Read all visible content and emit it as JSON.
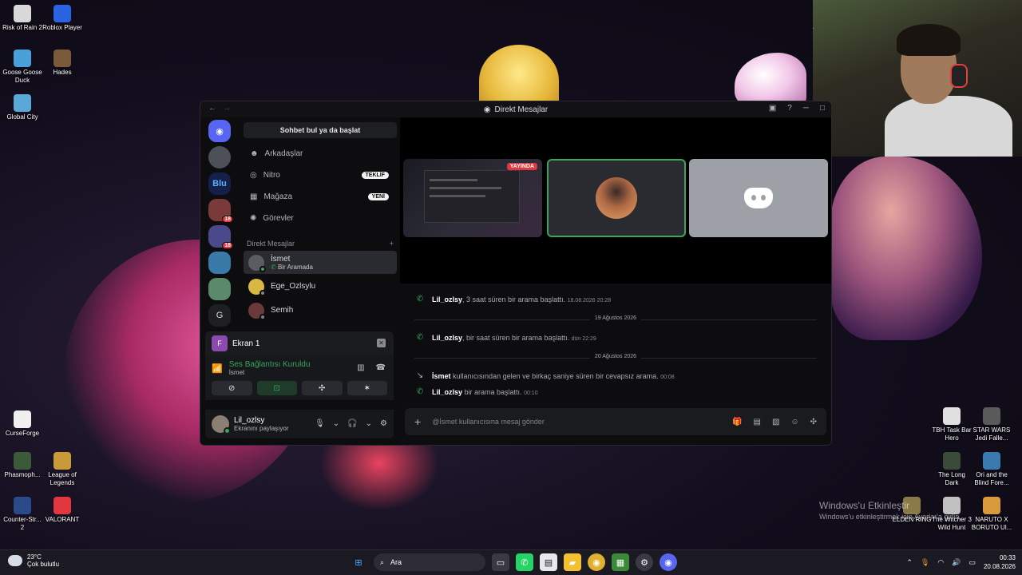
{
  "desktop": {
    "icons_left": [
      {
        "label": "Risk of Rain 2",
        "color": "#d8d8d8"
      },
      {
        "label": "Roblox Player",
        "color": "#2a64e0"
      },
      {
        "label": "Goose Goose Duck",
        "color": "#4aa0d8"
      },
      {
        "label": "Hades",
        "color": "#7a5a3a"
      },
      {
        "label": "Global City",
        "color": "#5aa8d8"
      },
      {
        "label": "CurseForge",
        "color": "#f0f0f0"
      },
      {
        "label": "Phasmoph...",
        "color": "#3a5a3a"
      },
      {
        "label": "League of Legends",
        "color": "#c89a3a"
      },
      {
        "label": "Counter-Str... 2",
        "color": "#2a4a8a"
      },
      {
        "label": "VALORANT",
        "color": "#e0383e"
      }
    ],
    "icons_right": [
      {
        "label": "TBH Task Bar Hero",
        "color": "#e0e0e0"
      },
      {
        "label": "STAR WARS Jedi Falle...",
        "color": "#5a5a5a"
      },
      {
        "label": "The Long Dark",
        "color": "#3a4a3a"
      },
      {
        "label": "Ori and the Blind Fore...",
        "color": "#3a7ab0"
      },
      {
        "label": "ELDEN RING",
        "color": "#8a7a4a"
      },
      {
        "label": "The Witcher 3 Wild Hunt",
        "color": "#c0c0c0"
      },
      {
        "label": "NARUTO X BORUTO Ul...",
        "color": "#d89a3a"
      }
    ],
    "webcam_marker": "1",
    "watermark_title": "Windows'u Etkinleştir",
    "watermark_sub": "Windows'u etkinleştirmek için Ayarlar'a gidin."
  },
  "discord": {
    "title": "Direkt Mesajlar",
    "nav_back": "←",
    "nav_forward": "→",
    "search_placeholder": "Sohbet bul ya da başlat",
    "nav": [
      {
        "label": "Arkadaşlar",
        "pill": ""
      },
      {
        "label": "Nitro",
        "pill": "TEKLİF"
      },
      {
        "label": "Mağaza",
        "pill": "YENİ"
      },
      {
        "label": "Görevler",
        "pill": ""
      }
    ],
    "dm_header": "Direkt Mesajlar",
    "dm_add": "+",
    "dms": [
      {
        "name": "İsmet",
        "sub": "Bir Aramada",
        "active": true,
        "avatar_color": "#5a5b63",
        "status": "#3ba55d"
      },
      {
        "name": "Ege_Ozlsylu",
        "sub": "",
        "active": false,
        "avatar_color": "#d8b840",
        "status": "#80848e"
      },
      {
        "name": "Semih",
        "sub": "",
        "active": false,
        "avatar_color": "#6a3a3a",
        "status": "#80848e"
      }
    ],
    "guild_badges": [
      "18",
      "18"
    ],
    "guild_letter": "G",
    "screenshare_label": "Ekran 1",
    "screenshare_letter": "F",
    "voice_status": "Ses Bağlantısı Kuruldu",
    "voice_channel": "İsmet",
    "user_name": "Lil_ozlsy",
    "user_status": "Ekranını paylaşıyor",
    "stream_live": "YAYINDA",
    "messages": [
      {
        "who": "Lil_ozlsy",
        "text": ", 3 saat süren bir arama başlattı.",
        "time": "18.08.2026 20:28",
        "missed": false
      },
      {
        "who": "Lil_ozlsy",
        "text": ", bir saat süren bir arama başlattı.",
        "time": "dün 22:29",
        "missed": false
      },
      {
        "who": "İsmet",
        "text": "kullanıcısından gelen ve birkaç saniye süren bir cevapsız arama.",
        "time": "00:08",
        "missed": true
      },
      {
        "who": "Lil_ozlsy",
        "text": "bir arama başlattı.",
        "time": "00:10",
        "missed": false
      }
    ],
    "dividers": [
      "19 Ağustos 2026",
      "20 Ağustos 2026"
    ],
    "composer_placeholder": "@İsmet kullanıcısına mesaj gönder"
  },
  "taskbar": {
    "temp": "23°C",
    "weather": "Çok bulutlu",
    "search": "Ara",
    "time": "00:33",
    "date": "20.08.2026"
  }
}
